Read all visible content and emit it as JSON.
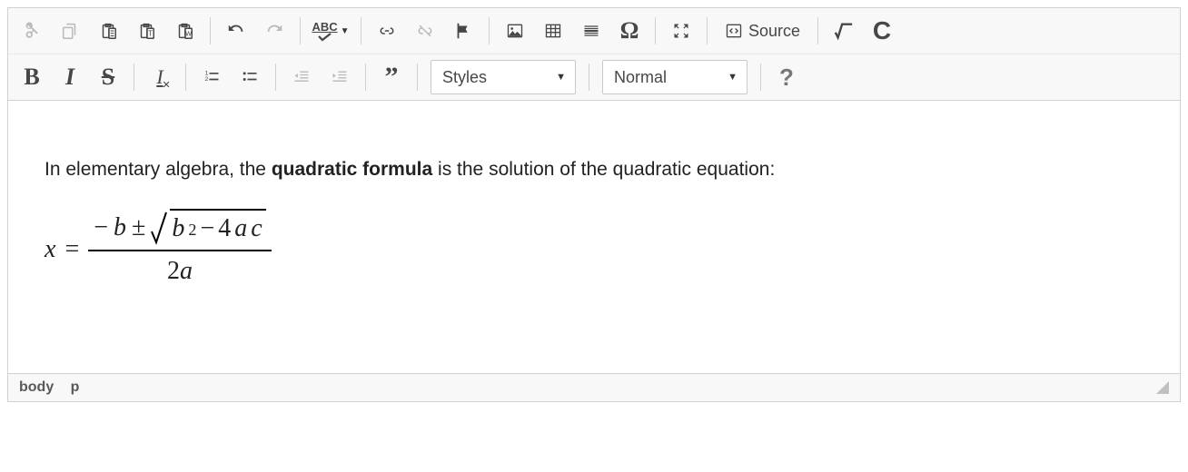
{
  "toolbar": {
    "source_label": "Source",
    "styles_label": "Styles",
    "format_label": "Normal",
    "spellcheck_abbr": "ABC",
    "buttons": {
      "cut": "Cut",
      "copy": "Copy",
      "paste": "Paste",
      "paste_text": "Paste as plain text",
      "paste_word": "Paste from Word",
      "undo": "Undo",
      "redo": "Redo",
      "spellcheck": "Spell Check As You Type",
      "link": "Link",
      "unlink": "Unlink",
      "anchor": "Anchor",
      "image": "Image",
      "table": "Table",
      "hr": "Horizontal Line",
      "special_char": "Special Character",
      "maximize": "Maximize",
      "source": "Source",
      "math": "Math",
      "chem": "Chemistry",
      "bold": "Bold",
      "italic": "Italic",
      "strike": "Strikethrough",
      "remove_format": "Remove Format",
      "ol": "Numbered List",
      "ul": "Bulleted List",
      "outdent": "Outdent",
      "indent": "Indent",
      "quote": "Block Quote",
      "styles_combo": "Formatting Styles",
      "format_combo": "Paragraph Format",
      "about": "About"
    }
  },
  "content": {
    "intro_pre": "In elementary algebra, the ",
    "intro_bold": "quadratic formula",
    "intro_post": " is the solution of the quadratic equation:",
    "formula_plain": "x = (-b ± √(b² − 4ac)) / (2a)"
  },
  "statusbar": {
    "path": [
      "body",
      "p"
    ]
  }
}
